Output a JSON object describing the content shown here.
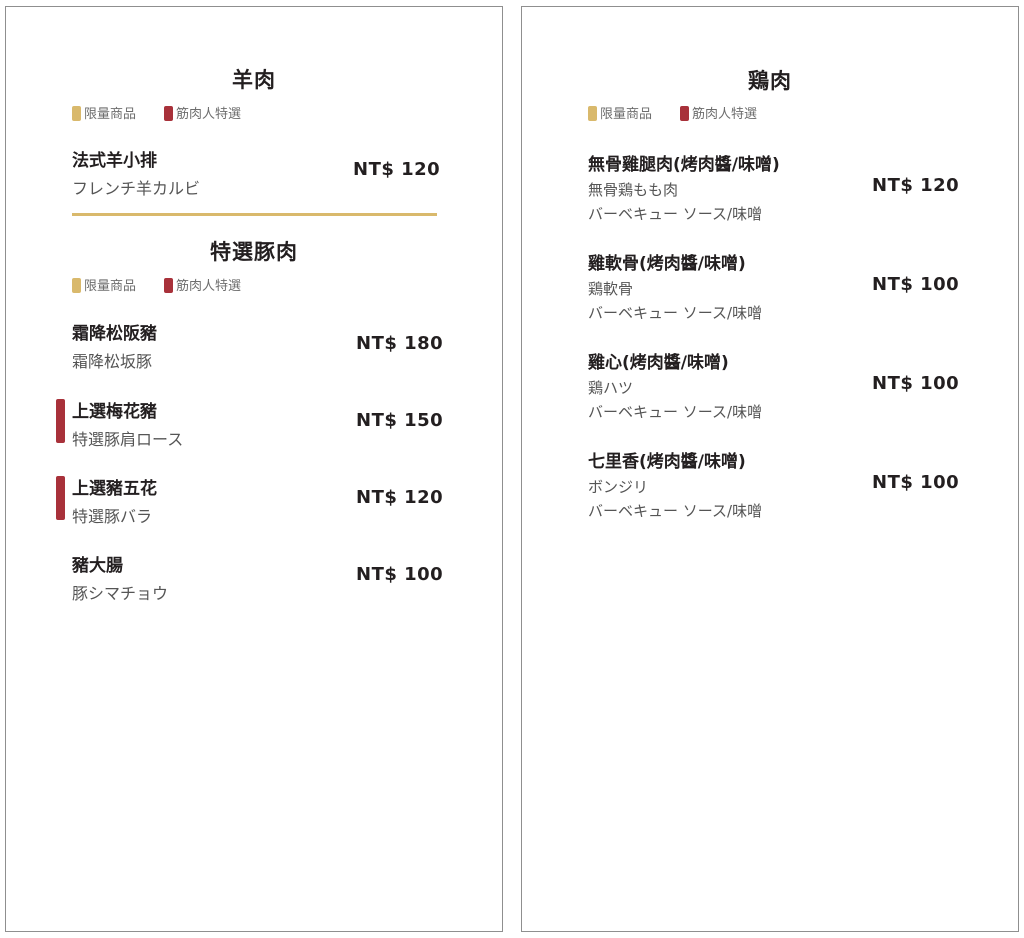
{
  "legend": {
    "limited": "限量商品",
    "special": "筋肉人特選"
  },
  "colors": {
    "gold": "#d9b96c",
    "red": "#a8313a",
    "text": "#231f20",
    "sub": "#555555"
  },
  "left": {
    "lamb": {
      "title": "羊肉",
      "items": [
        {
          "name": "法式羊小排",
          "sub": "フレンチ羊カルビ",
          "price": "NT$ 120"
        }
      ]
    },
    "pork": {
      "title": "特選豚肉",
      "items": [
        {
          "name": "霜降松阪豬",
          "sub": "霜降松坂豚",
          "price": "NT$ 180"
        },
        {
          "name": "上選梅花豬",
          "sub": "特選豚肩ロース",
          "price": "NT$ 150"
        },
        {
          "name": "上選豬五花",
          "sub": "特選豚バラ",
          "price": "NT$ 120"
        },
        {
          "name": "豬大腸",
          "sub": "豚シマチョウ",
          "price": "NT$ 100"
        }
      ]
    }
  },
  "right": {
    "chicken": {
      "title": "鶏肉",
      "items": [
        {
          "name": "無骨雞腿肉(烤肉醬/味噌)",
          "sub": "無骨鶏もも肉",
          "sub2": "バーベキュー ソース/味噌",
          "price": "NT$ 120"
        },
        {
          "name": "雞軟骨(烤肉醬/味噌)",
          "sub": "鶏軟骨",
          "sub2": "バーベキュー ソース/味噌",
          "price": "NT$ 100"
        },
        {
          "name": "雞心(烤肉醬/味噌)",
          "sub": "鶏ハツ",
          "sub2": "バーベキュー ソース/味噌",
          "price": "NT$ 100"
        },
        {
          "name": "七里香(烤肉醬/味噌)",
          "sub": "ボンジリ",
          "sub2": "バーベキュー ソース/味噌",
          "price": "NT$ 100"
        }
      ]
    }
  }
}
